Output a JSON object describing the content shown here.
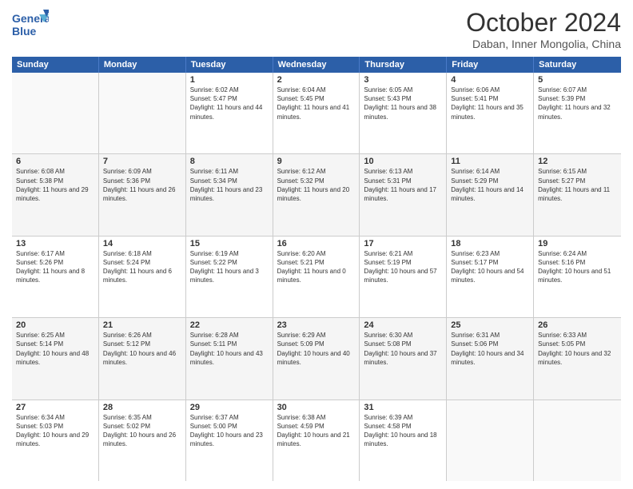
{
  "logo": {
    "line1": "General",
    "line2": "Blue"
  },
  "title": "October 2024",
  "location": "Daban, Inner Mongolia, China",
  "weekdays": [
    "Sunday",
    "Monday",
    "Tuesday",
    "Wednesday",
    "Thursday",
    "Friday",
    "Saturday"
  ],
  "rows": [
    [
      {
        "day": "",
        "empty": true
      },
      {
        "day": "",
        "empty": true
      },
      {
        "day": "1",
        "sunrise": "6:02 AM",
        "sunset": "5:47 PM",
        "daylight": "11 hours and 44 minutes."
      },
      {
        "day": "2",
        "sunrise": "6:04 AM",
        "sunset": "5:45 PM",
        "daylight": "11 hours and 41 minutes."
      },
      {
        "day": "3",
        "sunrise": "6:05 AM",
        "sunset": "5:43 PM",
        "daylight": "11 hours and 38 minutes."
      },
      {
        "day": "4",
        "sunrise": "6:06 AM",
        "sunset": "5:41 PM",
        "daylight": "11 hours and 35 minutes."
      },
      {
        "day": "5",
        "sunrise": "6:07 AM",
        "sunset": "5:39 PM",
        "daylight": "11 hours and 32 minutes."
      }
    ],
    [
      {
        "day": "6",
        "sunrise": "6:08 AM",
        "sunset": "5:38 PM",
        "daylight": "11 hours and 29 minutes."
      },
      {
        "day": "7",
        "sunrise": "6:09 AM",
        "sunset": "5:36 PM",
        "daylight": "11 hours and 26 minutes."
      },
      {
        "day": "8",
        "sunrise": "6:11 AM",
        "sunset": "5:34 PM",
        "daylight": "11 hours and 23 minutes."
      },
      {
        "day": "9",
        "sunrise": "6:12 AM",
        "sunset": "5:32 PM",
        "daylight": "11 hours and 20 minutes."
      },
      {
        "day": "10",
        "sunrise": "6:13 AM",
        "sunset": "5:31 PM",
        "daylight": "11 hours and 17 minutes."
      },
      {
        "day": "11",
        "sunrise": "6:14 AM",
        "sunset": "5:29 PM",
        "daylight": "11 hours and 14 minutes."
      },
      {
        "day": "12",
        "sunrise": "6:15 AM",
        "sunset": "5:27 PM",
        "daylight": "11 hours and 11 minutes."
      }
    ],
    [
      {
        "day": "13",
        "sunrise": "6:17 AM",
        "sunset": "5:26 PM",
        "daylight": "11 hours and 8 minutes."
      },
      {
        "day": "14",
        "sunrise": "6:18 AM",
        "sunset": "5:24 PM",
        "daylight": "11 hours and 6 minutes."
      },
      {
        "day": "15",
        "sunrise": "6:19 AM",
        "sunset": "5:22 PM",
        "daylight": "11 hours and 3 minutes."
      },
      {
        "day": "16",
        "sunrise": "6:20 AM",
        "sunset": "5:21 PM",
        "daylight": "11 hours and 0 minutes."
      },
      {
        "day": "17",
        "sunrise": "6:21 AM",
        "sunset": "5:19 PM",
        "daylight": "10 hours and 57 minutes."
      },
      {
        "day": "18",
        "sunrise": "6:23 AM",
        "sunset": "5:17 PM",
        "daylight": "10 hours and 54 minutes."
      },
      {
        "day": "19",
        "sunrise": "6:24 AM",
        "sunset": "5:16 PM",
        "daylight": "10 hours and 51 minutes."
      }
    ],
    [
      {
        "day": "20",
        "sunrise": "6:25 AM",
        "sunset": "5:14 PM",
        "daylight": "10 hours and 48 minutes."
      },
      {
        "day": "21",
        "sunrise": "6:26 AM",
        "sunset": "5:12 PM",
        "daylight": "10 hours and 46 minutes."
      },
      {
        "day": "22",
        "sunrise": "6:28 AM",
        "sunset": "5:11 PM",
        "daylight": "10 hours and 43 minutes."
      },
      {
        "day": "23",
        "sunrise": "6:29 AM",
        "sunset": "5:09 PM",
        "daylight": "10 hours and 40 minutes."
      },
      {
        "day": "24",
        "sunrise": "6:30 AM",
        "sunset": "5:08 PM",
        "daylight": "10 hours and 37 minutes."
      },
      {
        "day": "25",
        "sunrise": "6:31 AM",
        "sunset": "5:06 PM",
        "daylight": "10 hours and 34 minutes."
      },
      {
        "day": "26",
        "sunrise": "6:33 AM",
        "sunset": "5:05 PM",
        "daylight": "10 hours and 32 minutes."
      }
    ],
    [
      {
        "day": "27",
        "sunrise": "6:34 AM",
        "sunset": "5:03 PM",
        "daylight": "10 hours and 29 minutes."
      },
      {
        "day": "28",
        "sunrise": "6:35 AM",
        "sunset": "5:02 PM",
        "daylight": "10 hours and 26 minutes."
      },
      {
        "day": "29",
        "sunrise": "6:37 AM",
        "sunset": "5:00 PM",
        "daylight": "10 hours and 23 minutes."
      },
      {
        "day": "30",
        "sunrise": "6:38 AM",
        "sunset": "4:59 PM",
        "daylight": "10 hours and 21 minutes."
      },
      {
        "day": "31",
        "sunrise": "6:39 AM",
        "sunset": "4:58 PM",
        "daylight": "10 hours and 18 minutes."
      },
      {
        "day": "",
        "empty": true
      },
      {
        "day": "",
        "empty": true
      }
    ]
  ]
}
